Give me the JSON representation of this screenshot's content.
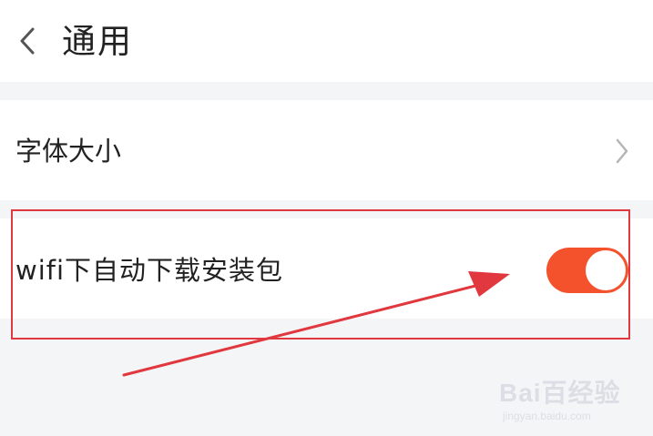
{
  "header": {
    "back_icon": "chevron-left-icon",
    "title": "通用"
  },
  "settings": {
    "font_size": {
      "label": "字体大小",
      "icon": "chevron-right-icon"
    },
    "wifi_auto_download": {
      "label": "wifi下自动下载安装包",
      "toggle_on": true
    }
  },
  "annotation": {
    "highlight_color": "#e0383e",
    "arrow_color": "#e0383e"
  },
  "watermark": {
    "logo": "Bai百经验",
    "url": "jingyan.baidu.com"
  },
  "colors": {
    "toggle_on": "#f4522d",
    "background": "#f4f5f7",
    "surface": "#ffffff"
  }
}
